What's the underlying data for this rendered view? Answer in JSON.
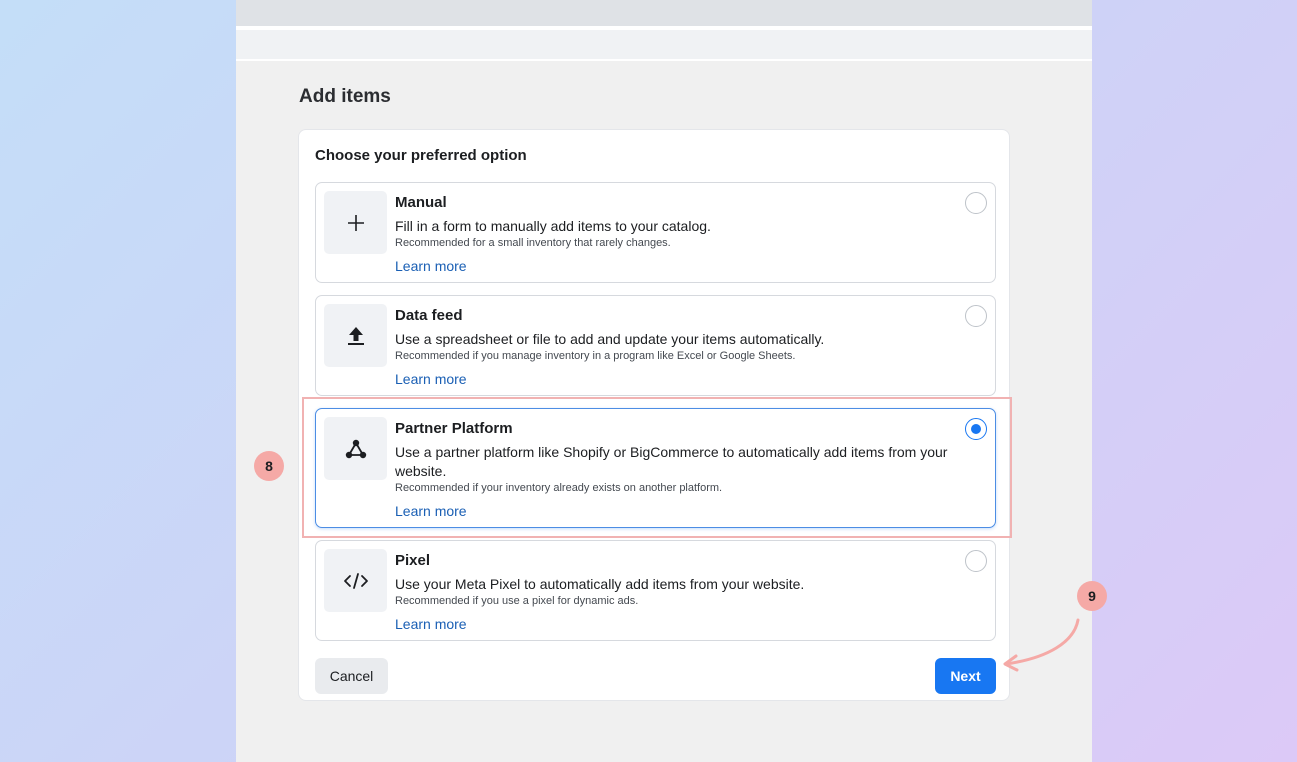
{
  "page": {
    "title": "Add items"
  },
  "card": {
    "title": "Choose your preferred option"
  },
  "options": [
    {
      "title": "Manual",
      "description": "Fill in a form to manually add items to your catalog.",
      "recommendation": "Recommended for a small inventory that rarely changes.",
      "link": "Learn more",
      "icon": "plus-icon",
      "selected": false
    },
    {
      "title": "Data feed",
      "description": "Use a spreadsheet or file to add and update your items automatically.",
      "recommendation": "Recommended if you manage inventory in a program like Excel or Google Sheets.",
      "link": "Learn more",
      "icon": "upload-icon",
      "selected": false
    },
    {
      "title": "Partner Platform",
      "description": "Use a partner platform like Shopify or BigCommerce to automatically add items from your website.",
      "recommendation": "Recommended if your inventory already exists on another platform.",
      "link": "Learn more",
      "icon": "partner-network-icon",
      "selected": true
    },
    {
      "title": "Pixel",
      "description": "Use your Meta Pixel to automatically add items from your website.",
      "recommendation": "Recommended if you use a pixel for dynamic ads.",
      "link": "Learn more",
      "icon": "code-icon",
      "selected": false
    }
  ],
  "buttons": {
    "cancel": "Cancel",
    "next": "Next"
  },
  "annotations": {
    "step_8": "8",
    "step_9": "9"
  },
  "colors": {
    "accent": "#1877f2",
    "link": "#1a5fb4",
    "annotation": "#f5a9a6",
    "highlight_border": "#f1b2b2"
  }
}
